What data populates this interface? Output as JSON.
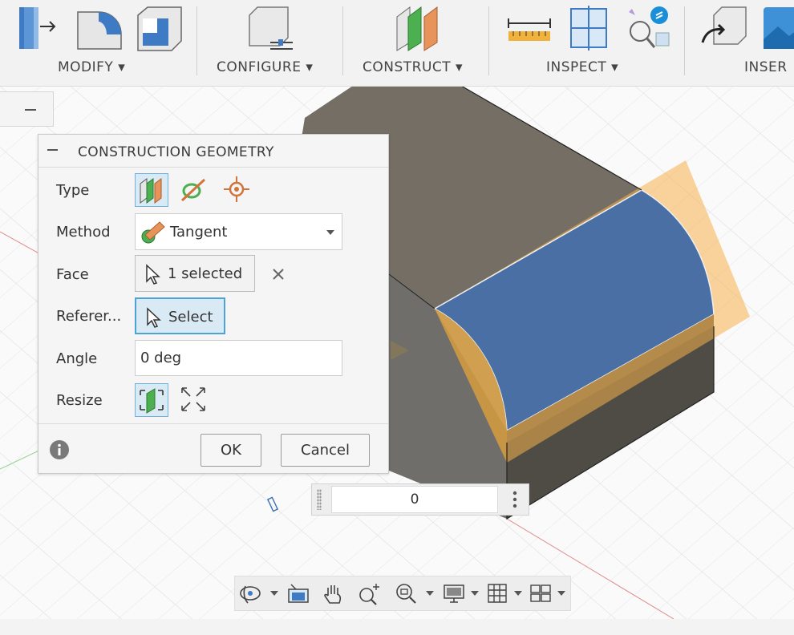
{
  "toolbar": {
    "groups": [
      {
        "label": "MODIFY ▾"
      },
      {
        "label": "CONFIGURE ▾"
      },
      {
        "label": "CONSTRUCT ▾"
      },
      {
        "label": "INSPECT ▾"
      },
      {
        "label": "INSER"
      }
    ],
    "icons": [
      "press-pull-icon",
      "fillet-icon",
      "shell-icon",
      "configure-table-icon",
      "midplane-icon",
      "measure-icon",
      "section-analysis-icon",
      "interference-icon",
      "insert-derive-icon",
      "insert-canvas-icon"
    ]
  },
  "dialog": {
    "title": "CONSTRUCTION GEOMETRY",
    "rows": {
      "type": {
        "label": "Type"
      },
      "method": {
        "label": "Method",
        "value": "Tangent"
      },
      "face": {
        "label": "Face",
        "value": "1 selected"
      },
      "reference": {
        "label": "Referer...",
        "value": "Select"
      },
      "angle": {
        "label": "Angle",
        "value": "0 deg"
      },
      "resize": {
        "label": "Resize"
      }
    },
    "ok_label": "OK",
    "cancel_label": "Cancel"
  },
  "value_widget": {
    "value": "0"
  },
  "navbar": {
    "icons": [
      "orbit-icon",
      "look-at-icon",
      "pan-icon",
      "zoom-icon",
      "fit-icon",
      "display-settings-icon",
      "grid-icon",
      "viewports-icon"
    ]
  },
  "colors": {
    "accent": "#4da2d6",
    "face_blue": "#4a6fa5",
    "plane_orange": "#f5b04a",
    "body_gray": "#6e6a62"
  }
}
